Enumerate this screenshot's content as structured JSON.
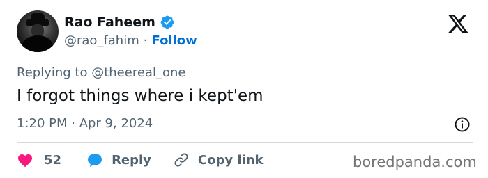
{
  "author": {
    "name": "Rao Faheem",
    "handle": "@rao_fahim",
    "separator": "·",
    "follow_label": "Follow",
    "verified_color": "#1d9bf0"
  },
  "tweet": {
    "replying_prefix": "Replying to",
    "replying_to": "@theereal_one",
    "text": "I forgot things where i kept'em",
    "timestamp": "1:20 PM · Apr 9, 2024"
  },
  "actions": {
    "likes_count": "52",
    "reply_label": "Reply",
    "copy_link_label": "Copy link"
  },
  "icons": {
    "platform": "x-logo-icon",
    "info": "info-icon",
    "like": "heart-icon",
    "reply": "speech-bubble-icon",
    "copy": "link-icon"
  },
  "colors": {
    "heart": "#f91880",
    "reply_bubble": "#1d9bf0",
    "follow": "#006fd6",
    "muted_text": "#536471"
  },
  "watermark": "boredpanda.com"
}
